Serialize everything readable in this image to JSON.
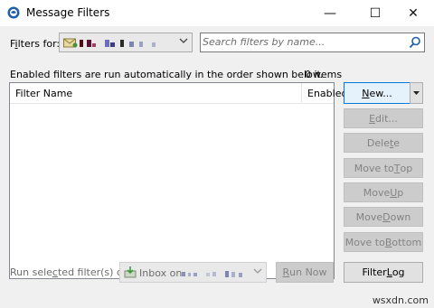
{
  "window": {
    "title": "Message Filters",
    "minimize_glyph": "—",
    "maximize_glyph": "☐",
    "close_glyph": "✕"
  },
  "filters_for": {
    "label_prefix": "F",
    "label_underlined": "i",
    "label_rest": "lters for:"
  },
  "search": {
    "placeholder": "Search filters by name..."
  },
  "info_text": "Enabled filters are run automatically in the order shown below.",
  "filter_count": "0 items",
  "list": {
    "columns": [
      "Filter Name",
      "Enabled"
    ],
    "rows": []
  },
  "buttons": {
    "new": {
      "pre": "",
      "u": "N",
      "post": "ew..."
    },
    "edit": {
      "pre": "",
      "u": "E",
      "post": "dit..."
    },
    "delete": {
      "pre": "Dele",
      "u": "t",
      "post": "e"
    },
    "move_top": {
      "pre": "Move to ",
      "u": "T",
      "post": "op"
    },
    "move_up": {
      "pre": "Move ",
      "u": "U",
      "post": "p"
    },
    "move_down": {
      "pre": "Move ",
      "u": "D",
      "post": "own"
    },
    "move_bottom": {
      "pre": "Move to ",
      "u": "B",
      "post": "ottom"
    },
    "run_now": {
      "pre": "",
      "u": "R",
      "post": "un Now"
    },
    "filter_log": {
      "pre": "Filter ",
      "u": "L",
      "post": "og"
    }
  },
  "run_on": {
    "label_pre": "Run sele",
    "label_u": "c",
    "label_post": "ted filter(s) on:",
    "value": "Inbox on"
  },
  "watermark": "wsxdn.com",
  "colors": {
    "focus_border": "#0078d7",
    "dialog_bg": "#f0f0f0",
    "disabled_text": "#838383"
  }
}
